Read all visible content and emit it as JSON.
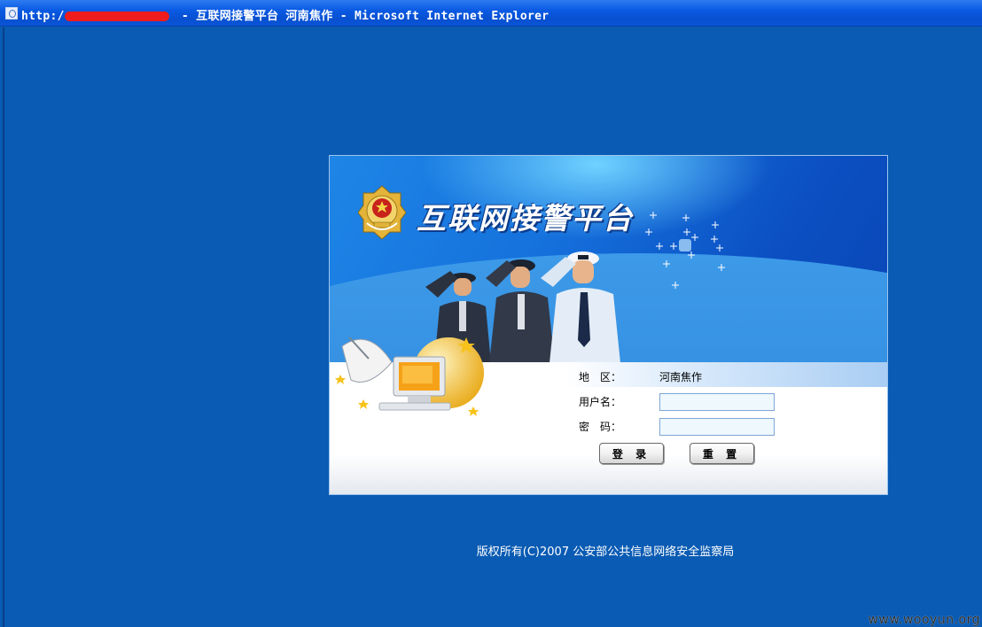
{
  "window": {
    "title_prefix": "http:/",
    "title_suffix": " - 互联网接警平台 河南焦作 - Microsoft Internet Explorer"
  },
  "banner": {
    "title": "互联网接警平台"
  },
  "login": {
    "region_label": "地　区：",
    "region_value": "河南焦作",
    "username_label": "用户名：",
    "username_value": "",
    "password_label": "密　码：",
    "password_value": "",
    "login_button": "登 录",
    "reset_button": "重 置"
  },
  "footer": {
    "copyright": "版权所有(C)2007 公安部公共信息网络安全监察局"
  },
  "watermark": "www.wooyun.org",
  "colors": {
    "page_background": "#0a5bb3",
    "titlebar": "#0a5ae3",
    "input_background": "#eef8fd",
    "redaction": "#ee1c1c"
  }
}
